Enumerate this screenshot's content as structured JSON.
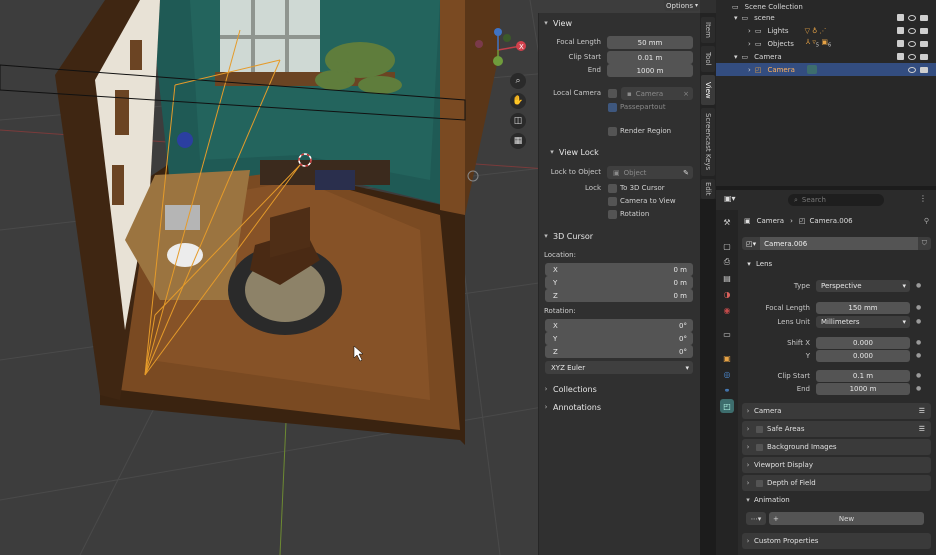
{
  "viewport": {
    "options_label": "Options",
    "gizmo": {
      "x": "X",
      "y": "Y",
      "z": "Z"
    }
  },
  "npanel": {
    "view": {
      "header": "View",
      "focal_length_label": "Focal Length",
      "focal_length_value": "50 mm",
      "clip_start_label": "Clip Start",
      "clip_start_value": "0.01 m",
      "end_label": "End",
      "end_value": "1000 m",
      "local_camera_label": "Local Camera",
      "local_camera_placeholder": "Camera",
      "passepartout_label": "Passepartout",
      "render_region_label": "Render Region"
    },
    "view_lock": {
      "header": "View Lock",
      "lock_to_object_label": "Lock to Object",
      "lock_to_object_placeholder": "Object",
      "lock_label": "Lock",
      "to_3d_cursor_label": "To 3D Cursor",
      "camera_to_view_label": "Camera to View",
      "rotation_label": "Rotation"
    },
    "cursor": {
      "header": "3D Cursor",
      "location_label": "Location:",
      "loc": [
        {
          "axis": "X",
          "value": "0 m"
        },
        {
          "axis": "Y",
          "value": "0 m"
        },
        {
          "axis": "Z",
          "value": "0 m"
        }
      ],
      "rotation_label": "Rotation:",
      "rot": [
        {
          "axis": "X",
          "value": "0°"
        },
        {
          "axis": "Y",
          "value": "0°"
        },
        {
          "axis": "Z",
          "value": "0°"
        }
      ],
      "rotation_mode": "XYZ Euler"
    },
    "collections_label": "Collections",
    "annotations_label": "Annotations"
  },
  "vtabs": [
    "Item",
    "Tool",
    "View",
    "Screencast Keys",
    "Edit"
  ],
  "outliner": {
    "scene_collection": "Scene Collection",
    "scene": "scene",
    "lights": "Lights",
    "objects": "Objects",
    "camera_collection": "Camera",
    "camera_object": "Camera",
    "objects_badge": "5",
    "objects_badge2": "6"
  },
  "properties": {
    "search_placeholder": "Search",
    "breadcrumb_object": "Camera",
    "breadcrumb_data": "Camera.006",
    "data_name": "Camera.006",
    "lens": {
      "header": "Lens",
      "type_label": "Type",
      "type_value": "Perspective",
      "focal_length_label": "Focal Length",
      "focal_length_value": "150 mm",
      "lens_unit_label": "Lens Unit",
      "lens_unit_value": "Millimeters",
      "shift_x_label": "Shift X",
      "shift_x_value": "0.000",
      "y_label": "Y",
      "y_value": "0.000",
      "clip_start_label": "Clip Start",
      "clip_start_value": "0.1 m",
      "end_label": "End",
      "end_value": "1000 m"
    },
    "sections": {
      "camera": "Camera",
      "safe_areas": "Safe Areas",
      "background_images": "Background Images",
      "viewport_display": "Viewport Display",
      "depth_of_field": "Depth of Field",
      "animation": "Animation",
      "custom_properties": "Custom Properties"
    },
    "new_label": "New"
  },
  "colors": {
    "selected_row": "#334d80",
    "accent_blue": "#4772b3",
    "orange_lines": "#e59b2a"
  }
}
